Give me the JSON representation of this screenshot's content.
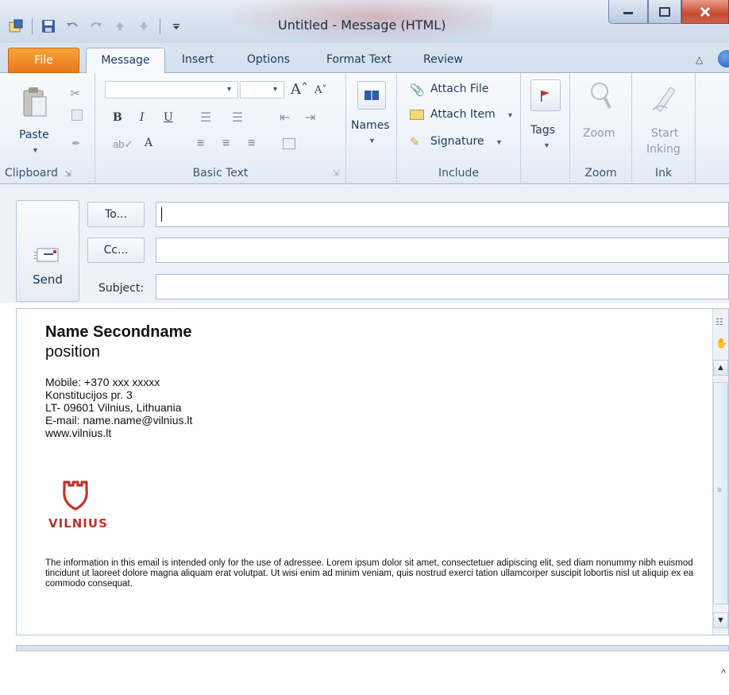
{
  "window": {
    "title": "Untitled - Message (HTML)",
    "accent": "#e8751c"
  },
  "quick_access": {
    "icons": [
      "outlook-icon",
      "save-icon",
      "undo-icon",
      "redo-icon",
      "up-arrow-icon",
      "down-arrow-icon",
      "customize-qat-icon"
    ]
  },
  "tabs": [
    "File",
    "Message",
    "Insert",
    "Options",
    "Format Text",
    "Review"
  ],
  "ribbon": {
    "clipboard": {
      "paste": "Paste",
      "group": "Clipboard"
    },
    "basic_text": {
      "group": "Basic Text"
    },
    "names": {
      "label": "Names"
    },
    "include": {
      "attach_file": "Attach File",
      "attach_item": "Attach Item",
      "signature": "Signature",
      "group": "Include"
    },
    "tags": {
      "label": "Tags"
    },
    "zoom": {
      "label": "Zoom",
      "group": "Zoom"
    },
    "ink": {
      "label_1": "Start",
      "label_2": "Inking",
      "group": "Ink"
    }
  },
  "compose": {
    "send": "Send",
    "to": "To...",
    "cc": "Cc...",
    "subject": "Subject:",
    "to_value": "",
    "cc_value": "",
    "subject_value": ""
  },
  "signature": {
    "name": "Name Secondname",
    "position": "position",
    "mobile": "Mobile: +370 xxx xxxxx",
    "address1": "Konstitucijos pr. 3",
    "address2": "LT- 09601 Vilnius, Lithuania",
    "email": "E-mail: name.name@vilnius.lt",
    "web": "www.vilnius.lt",
    "logo_text": "VILNIUS",
    "logo_color": "#c0332c",
    "disclaimer": "The information in this email is intended only for the use of adressee. Lorem ipsum dolor sit amet, consectetuer adipiscing elit, sed diam nonummy nibh euismod tincidunt ut laoreet dolore magna aliquam erat volutpat. Ut wisi enim ad minim veniam, quis nostrud exerci tation ullamcorper suscipit lobortis nisl ut aliquip ex ea commodo consequat."
  }
}
